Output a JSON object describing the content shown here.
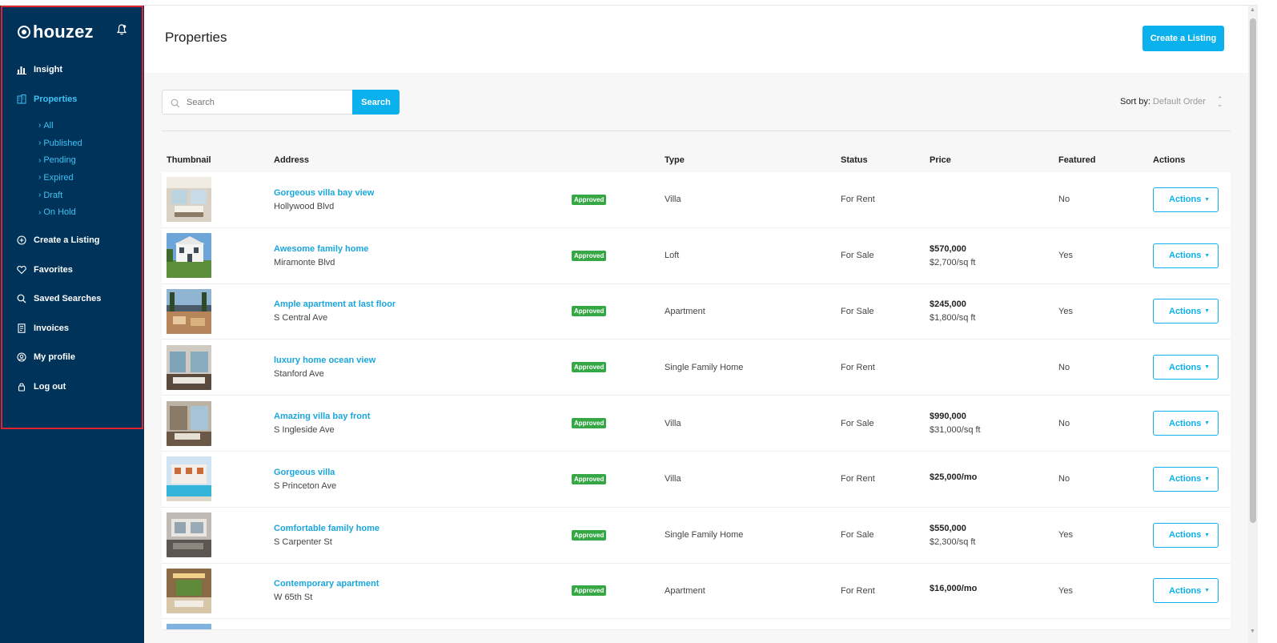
{
  "brand": {
    "name": "houzez"
  },
  "sidebar": {
    "items": [
      {
        "label": "Insight",
        "icon": "chart-icon"
      },
      {
        "label": "Properties",
        "icon": "building-icon",
        "active": true
      },
      {
        "label": "Create a Listing",
        "icon": "plus-circle-icon"
      },
      {
        "label": "Favorites",
        "icon": "heart-icon"
      },
      {
        "label": "Saved Searches",
        "icon": "search-icon"
      },
      {
        "label": "Invoices",
        "icon": "invoice-icon"
      },
      {
        "label": "My profile",
        "icon": "user-circle-icon"
      },
      {
        "label": "Log out",
        "icon": "lock-icon"
      }
    ],
    "subitems": [
      "All",
      "Published",
      "Pending",
      "Expired",
      "Draft",
      "On Hold"
    ]
  },
  "header": {
    "title": "Properties",
    "create_label": "Create a Listing"
  },
  "search": {
    "placeholder": "Search",
    "button_label": "Search"
  },
  "sort": {
    "label": "Sort by:",
    "value": "Default Order"
  },
  "table": {
    "headers": {
      "thumbnail": "Thumbnail",
      "address": "Address",
      "type": "Type",
      "status": "Status",
      "price": "Price",
      "featured": "Featured",
      "actions": "Actions"
    },
    "rows": [
      {
        "title": "Gorgeous villa bay view",
        "address": "Hollywood Blvd",
        "badge": "Approved",
        "type": "Villa",
        "status": "For Rent",
        "price": "",
        "price_sub": "",
        "featured": "No",
        "action": "Actions"
      },
      {
        "title": "Awesome family home",
        "address": "Miramonte Blvd",
        "badge": "Approved",
        "type": "Loft",
        "status": "For Sale",
        "price": "$570,000",
        "price_sub": "$2,700/sq ft",
        "featured": "Yes",
        "action": "Actions"
      },
      {
        "title": "Ample apartment at last floor",
        "address": "S Central Ave",
        "badge": "Approved",
        "type": "Apartment",
        "status": "For Sale",
        "price": "$245,000",
        "price_sub": "$1,800/sq ft",
        "featured": "Yes",
        "action": "Actions"
      },
      {
        "title": "luxury home ocean view",
        "address": "Stanford Ave",
        "badge": "Approved",
        "type": "Single Family Home",
        "status": "For Rent",
        "price": "",
        "price_sub": "",
        "featured": "No",
        "action": "Actions"
      },
      {
        "title": "Amazing villa bay front",
        "address": "S Ingleside Ave",
        "badge": "Approved",
        "type": "Villa",
        "status": "For Sale",
        "price": "$990,000",
        "price_sub": "$31,000/sq ft",
        "featured": "No",
        "action": "Actions"
      },
      {
        "title": "Gorgeous villa",
        "address": "S Princeton Ave",
        "badge": "Approved",
        "type": "Villa",
        "status": "For Rent",
        "price": "$25,000/mo",
        "price_sub": "",
        "featured": "No",
        "action": "Actions"
      },
      {
        "title": "Comfortable family home",
        "address": "S Carpenter St",
        "badge": "Approved",
        "type": "Single Family Home",
        "status": "For Sale",
        "price": "$550,000",
        "price_sub": "$2,300/sq ft",
        "featured": "Yes",
        "action": "Actions"
      },
      {
        "title": "Contemporary apartment",
        "address": "W 65th St",
        "badge": "Approved",
        "type": "Apartment",
        "status": "For Rent",
        "price": "$16,000/mo",
        "price_sub": "",
        "featured": "Yes",
        "action": "Actions"
      }
    ]
  },
  "colors": {
    "sidebar_bg": "#00335a",
    "accent": "#0ab1ec",
    "link": "#1aa6db",
    "badge_green": "#35a845",
    "highlight_border": "#e3222d"
  }
}
